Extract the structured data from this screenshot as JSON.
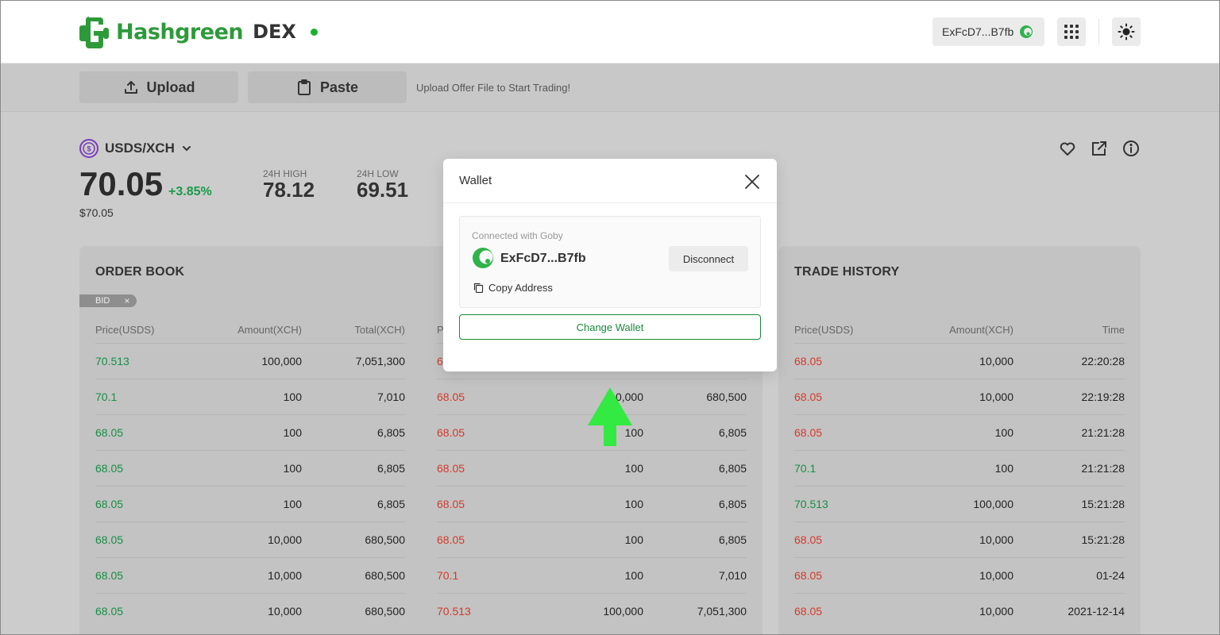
{
  "header": {
    "brand": "Hashgreen",
    "product": "DEX",
    "wallet_chip": "ExFcD7...B7fb",
    "colors": {
      "brand": "#2d9a3a",
      "live": "#16b22e"
    }
  },
  "actions": {
    "upload": "Upload",
    "paste": "Paste",
    "hint": "Upload Offer File to Start Trading!"
  },
  "market": {
    "pair": "USDS/XCH",
    "price": "70.05",
    "change": "+3.85%",
    "price_usd": "$70.05",
    "high_label": "24H HIGH",
    "high_value": "78.12",
    "low_label": "24H LOW",
    "low_value": "69.51"
  },
  "order_book": {
    "title": "ORDER BOOK",
    "filter": "BID",
    "columns": [
      "Price(USDS)",
      "Amount(XCH)",
      "Total(XCH)"
    ],
    "bids": [
      [
        "70.513",
        "100,000",
        "7,051,300"
      ],
      [
        "70.1",
        "100",
        "7,010"
      ],
      [
        "68.05",
        "100",
        "6,805"
      ],
      [
        "68.05",
        "100",
        "6,805"
      ],
      [
        "68.05",
        "100",
        "6,805"
      ],
      [
        "68.05",
        "10,000",
        "680,500"
      ],
      [
        "68.05",
        "10,000",
        "680,500"
      ],
      [
        "68.05",
        "10,000",
        "680,500"
      ]
    ],
    "asks_column_head": "P",
    "asks": [
      [
        "6",
        "",
        ""
      ],
      [
        "68.05",
        "0,000",
        "680,500"
      ],
      [
        "68.05",
        "100",
        "6,805"
      ],
      [
        "68.05",
        "100",
        "6,805"
      ],
      [
        "68.05",
        "100",
        "6,805"
      ],
      [
        "68.05",
        "100",
        "6,805"
      ],
      [
        "70.1",
        "100",
        "7,010"
      ],
      [
        "70.513",
        "100,000",
        "7,051,300"
      ]
    ]
  },
  "trade_history": {
    "title": "TRADE HISTORY",
    "columns": [
      "Price(USDS)",
      "Amount(XCH)",
      "Time"
    ],
    "rows": [
      [
        "68.05",
        "10,000",
        "22:20:28",
        "red"
      ],
      [
        "68.05",
        "10,000",
        "22:19:28",
        "red"
      ],
      [
        "68.05",
        "100",
        "21:21:28",
        "red"
      ],
      [
        "70.1",
        "100",
        "21:21:28",
        "green"
      ],
      [
        "70.513",
        "100,000",
        "15:21:28",
        "green"
      ],
      [
        "68.05",
        "10,000",
        "15:21:28",
        "red"
      ],
      [
        "68.05",
        "10,000",
        "01-24",
        "red"
      ],
      [
        "68.05",
        "10,000",
        "2021-12-14",
        "red"
      ]
    ]
  },
  "wallet_modal": {
    "title": "Wallet",
    "connected_label": "Connected with Goby",
    "address": "ExFcD7...B7fb",
    "disconnect": "Disconnect",
    "copy": "Copy Address",
    "change_wallet": "Change Wallet"
  }
}
